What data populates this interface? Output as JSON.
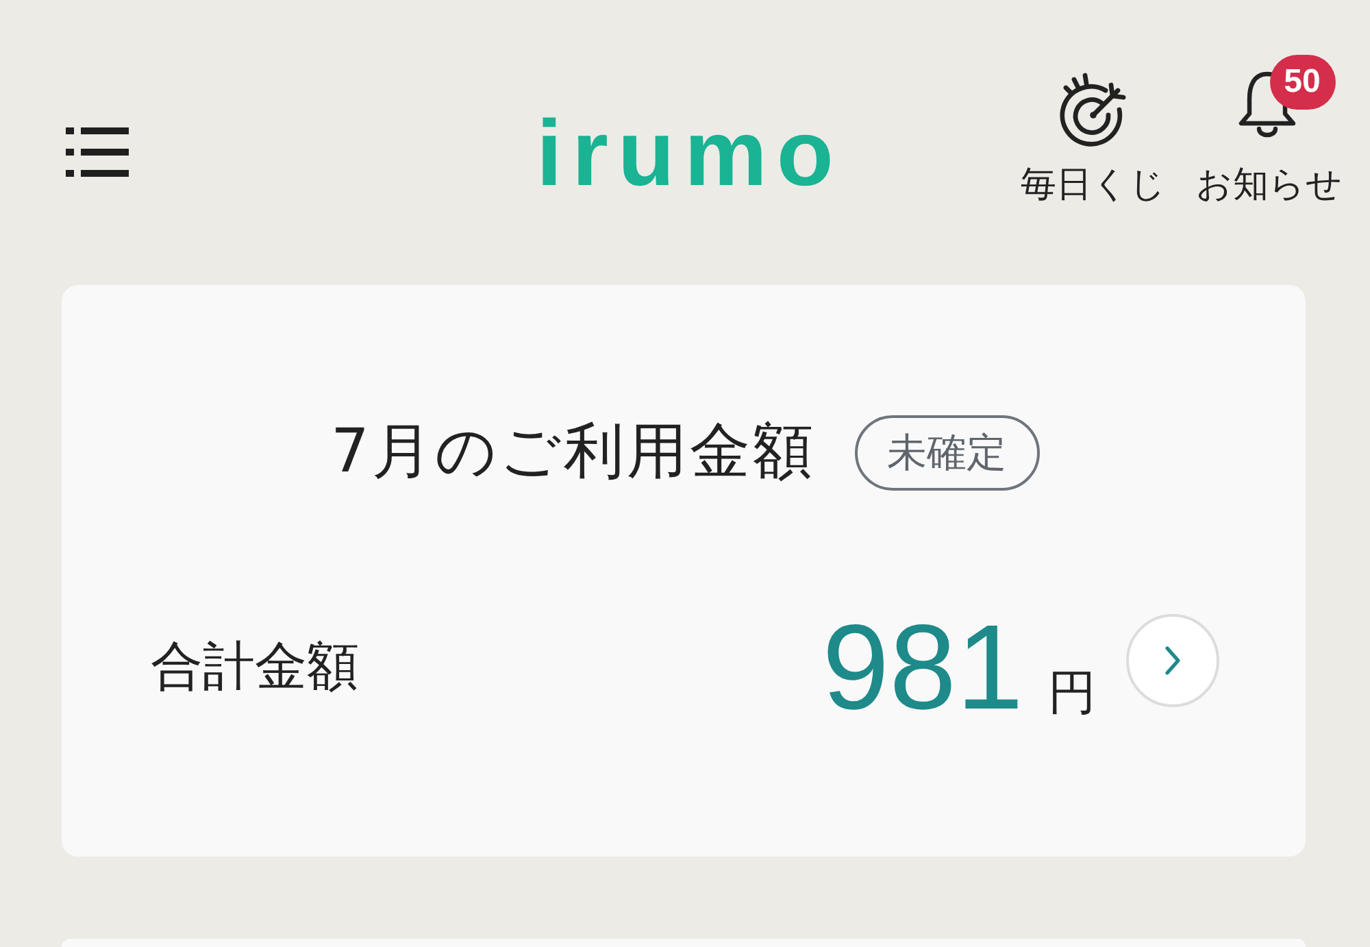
{
  "header": {
    "logo": "irumo",
    "actions": [
      {
        "kind": "lottery",
        "label": "毎日くじ"
      },
      {
        "kind": "notifications",
        "label": "お知らせ",
        "badge": "50"
      }
    ]
  },
  "billing_card": {
    "title": "7月のご利用金額",
    "status_badge": "未確定",
    "total_label": "合計金額",
    "amount": "981",
    "currency": "円"
  }
}
